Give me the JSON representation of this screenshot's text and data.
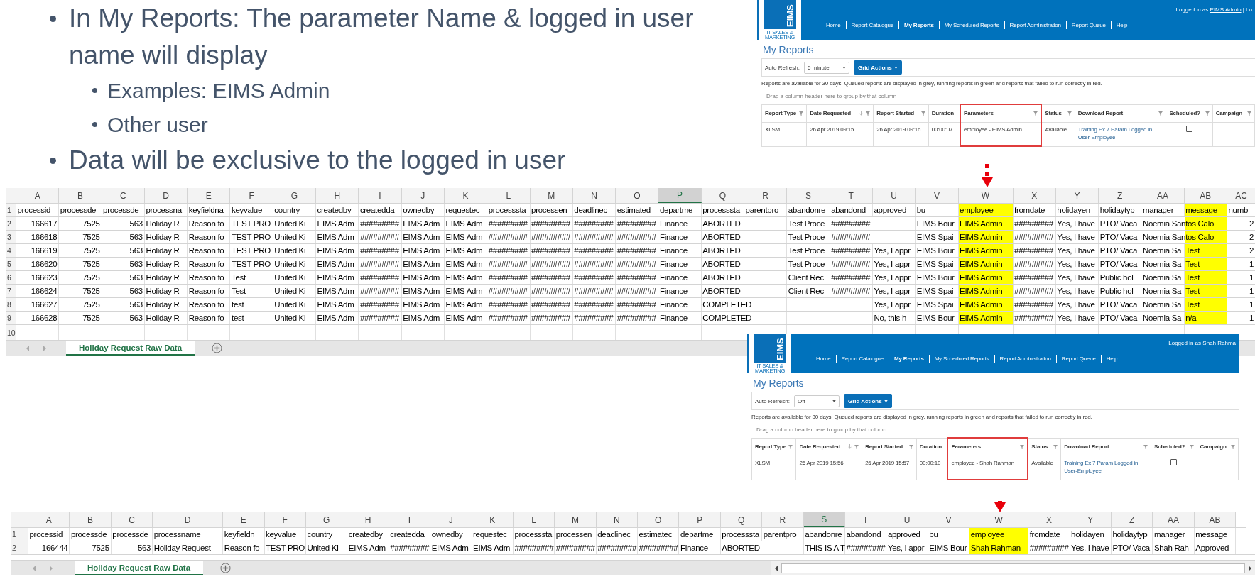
{
  "bullets": [
    {
      "text": "In My Reports: The parameter Name & logged in user name will display",
      "children": [
        {
          "text": "Examples: EIMS Admin"
        },
        {
          "text": "Other user"
        }
      ]
    },
    {
      "text": "Data will be exclusive to the logged in user"
    }
  ],
  "apps": [
    {
      "logo_text": "EIMS",
      "logo_subtitle": "IT SALES & MARKETING",
      "login_label": "Logged in as",
      "user": "EIMS Admin",
      "login_suffix": "| Lo",
      "nav": [
        {
          "label": "Home",
          "selected": false
        },
        {
          "label": "Report Catalogue",
          "selected": false
        },
        {
          "label": "My Reports",
          "selected": true
        },
        {
          "label": "My Scheduled Reports",
          "selected": false
        },
        {
          "label": "Report Administration",
          "selected": false
        },
        {
          "label": "Report Queue",
          "selected": false
        },
        {
          "label": "Help",
          "selected": false
        }
      ],
      "title": "My Reports",
      "auto_refresh_label": "Auto Refresh:",
      "auto_refresh_value": "5 minute",
      "grid_actions": "Grid Actions",
      "info": "Reports are available for 30 days. Queued reports are displayed in grey, running reports in green and reports that failed to run correctly in red.",
      "group_hint": "Drag a column header here to group by that column",
      "columns": [
        {
          "label": "Report Type",
          "sorted": false,
          "filter": true,
          "highlighted": false
        },
        {
          "label": "Date Requested",
          "sorted": true,
          "filter": true,
          "highlighted": false
        },
        {
          "label": "Report Started",
          "sorted": false,
          "filter": true,
          "highlighted": false
        },
        {
          "label": "Duration",
          "sorted": false,
          "filter": false,
          "highlighted": false
        },
        {
          "label": "Parameters",
          "sorted": false,
          "filter": true,
          "highlighted": true
        },
        {
          "label": "Status",
          "sorted": false,
          "filter": true,
          "highlighted": false
        },
        {
          "label": "Download Report",
          "sorted": false,
          "filter": true,
          "highlighted": false
        },
        {
          "label": "Scheduled?",
          "sorted": false,
          "filter": true,
          "highlighted": false
        },
        {
          "label": "Campaign",
          "sorted": false,
          "filter": true,
          "highlighted": false
        }
      ],
      "row": [
        {
          "kind": "text",
          "text": "XLSM"
        },
        {
          "kind": "text",
          "text": "26 Apr 2019 09:15"
        },
        {
          "kind": "text",
          "text": "26 Apr 2019 09:16"
        },
        {
          "kind": "text",
          "text": "00:00:07"
        },
        {
          "kind": "text",
          "text": "employee - EIMS Admin"
        },
        {
          "kind": "text",
          "text": "Available"
        },
        {
          "kind": "link",
          "text": "Training Ex 7 Param Logged in User-Employee"
        },
        {
          "kind": "checkbox",
          "checked": false
        }
      ]
    },
    {
      "logo_text": "EIMS",
      "logo_subtitle": "IT SALES & MARKETING",
      "login_label": "Logged in as",
      "user": "Shah Rahma",
      "nav": [
        {
          "label": "Home",
          "selected": false
        },
        {
          "label": "Report Catalogue",
          "selected": false
        },
        {
          "label": "My Reports",
          "selected": true
        },
        {
          "label": "My Scheduled Reports",
          "selected": false
        },
        {
          "label": "Report Administration",
          "selected": false
        },
        {
          "label": "Report Queue",
          "selected": false
        },
        {
          "label": "Help",
          "selected": false
        }
      ],
      "title": "My Reports",
      "auto_refresh_label": "Auto Refresh:",
      "auto_refresh_value": "Off",
      "grid_actions": "Grid Actions",
      "info": "Reports are available for 30 days. Queued reports are displayed in grey, running reports in green and reports that failed to run correctly in red.",
      "group_hint": "Drag a column header here to group by that column",
      "columns": [
        {
          "label": "Report Type",
          "sorted": false,
          "filter": true,
          "highlighted": false
        },
        {
          "label": "Date Requested",
          "sorted": true,
          "filter": true,
          "highlighted": false
        },
        {
          "label": "Report Started",
          "sorted": false,
          "filter": true,
          "highlighted": false
        },
        {
          "label": "Duration",
          "sorted": false,
          "filter": false,
          "highlighted": false
        },
        {
          "label": "Parameters",
          "sorted": false,
          "filter": true,
          "highlighted": true
        },
        {
          "label": "Status",
          "sorted": false,
          "filter": true,
          "highlighted": false
        },
        {
          "label": "Download Report",
          "sorted": false,
          "filter": true,
          "highlighted": false
        },
        {
          "label": "Scheduled?",
          "sorted": false,
          "filter": true,
          "highlighted": false
        },
        {
          "label": "Campaign",
          "sorted": false,
          "filter": true,
          "highlighted": false
        }
      ],
      "row": [
        {
          "kind": "text",
          "text": "XLSM"
        },
        {
          "kind": "text",
          "text": "26 Apr 2019 15:56"
        },
        {
          "kind": "text",
          "text": "26 Apr 2019 15:57"
        },
        {
          "kind": "text",
          "text": "00:00:10"
        },
        {
          "kind": "text",
          "text": "employee - Shah Rahman"
        },
        {
          "kind": "text",
          "text": "Available"
        },
        {
          "kind": "link",
          "text": "Training Ex 7 Param Logged in User-Employee"
        },
        {
          "kind": "checkbox",
          "checked": false
        }
      ]
    }
  ],
  "sheets": [
    {
      "tab": "Holiday Request Raw Data",
      "columns": [
        {
          "letter": "A",
          "selected": false,
          "highlighted": false
        },
        {
          "letter": "B",
          "selected": false,
          "highlighted": false
        },
        {
          "letter": "C",
          "selected": false,
          "highlighted": false
        },
        {
          "letter": "D",
          "selected": false,
          "highlighted": false
        },
        {
          "letter": "E",
          "selected": false,
          "highlighted": false
        },
        {
          "letter": "F",
          "selected": false,
          "highlighted": false
        },
        {
          "letter": "G",
          "selected": false,
          "highlighted": false
        },
        {
          "letter": "H",
          "selected": false,
          "highlighted": false
        },
        {
          "letter": "I",
          "selected": false,
          "highlighted": false
        },
        {
          "letter": "J",
          "selected": false,
          "highlighted": false
        },
        {
          "letter": "K",
          "selected": false,
          "highlighted": false
        },
        {
          "letter": "L",
          "selected": false,
          "highlighted": false
        },
        {
          "letter": "M",
          "selected": false,
          "highlighted": false
        },
        {
          "letter": "N",
          "selected": false,
          "highlighted": false
        },
        {
          "letter": "O",
          "selected": false,
          "highlighted": false
        },
        {
          "letter": "P",
          "selected": true,
          "highlighted": false
        },
        {
          "letter": "Q",
          "selected": false,
          "highlighted": false
        },
        {
          "letter": "R",
          "selected": false,
          "highlighted": false
        },
        {
          "letter": "S",
          "selected": false,
          "highlighted": false
        },
        {
          "letter": "T",
          "selected": false,
          "highlighted": false
        },
        {
          "letter": "U",
          "selected": false,
          "highlighted": false
        },
        {
          "letter": "V",
          "selected": false,
          "highlighted": false
        },
        {
          "letter": "W",
          "selected": false,
          "highlighted": true
        },
        {
          "letter": "X",
          "selected": false,
          "highlighted": false
        },
        {
          "letter": "Y",
          "selected": false,
          "highlighted": false
        },
        {
          "letter": "Z",
          "selected": false,
          "highlighted": false
        },
        {
          "letter": "AA",
          "selected": false,
          "highlighted": false
        },
        {
          "letter": "AB",
          "selected": false,
          "highlighted": true
        },
        {
          "letter": "AC",
          "selected": false,
          "highlighted": false
        }
      ],
      "rows": [
        {
          "number": "1",
          "cells": [
            "processid",
            "processde",
            "processde",
            "processna",
            "keyfieldna",
            "keyvalue",
            "country",
            "createdby",
            "createdda",
            "ownedby",
            "requestec",
            "processsta",
            "processen",
            "deadlinec",
            "estimated",
            "departme",
            "processsta",
            "parentpro",
            "abandonre",
            "abandond",
            "approved",
            "bu",
            "employee",
            "fromdate",
            "holidayen",
            "holidaytyp",
            "manager",
            "message",
            "numb"
          ]
        },
        {
          "number": "2",
          "cells": [
            "166617",
            "7525",
            "563",
            "Holiday R",
            "Reason fo",
            "TEST PRO",
            "United Ki",
            "EIMS Adm",
            "#########",
            "EIMS Adm",
            "EIMS Adm",
            "#########",
            "#########",
            "#########",
            "#########",
            "Finance",
            "ABORTED",
            "",
            "Test Proce",
            "#########",
            "",
            "EIMS Bour",
            "EIMS Admin",
            "#########",
            "Yes, I have",
            "PTO/ Vaca",
            "Noemia Santos Calo",
            "",
            "2"
          ]
        },
        {
          "number": "3",
          "cells": [
            "166618",
            "7525",
            "563",
            "Holiday R",
            "Reason fo",
            "TEST PRO",
            "United Ki",
            "EIMS Adm",
            "#########",
            "EIMS Adm",
            "EIMS Adm",
            "#########",
            "#########",
            "#########",
            "#########",
            "Finance",
            "ABORTED",
            "",
            "Test Proce",
            "#########",
            "",
            "EIMS Spai",
            "EIMS Admin",
            "#########",
            "Yes, I have",
            "PTO/ Vaca",
            "Noemia Santos Calo",
            "",
            "2"
          ]
        },
        {
          "number": "4",
          "cells": [
            "166619",
            "7525",
            "563",
            "Holiday R",
            "Reason fo",
            "TEST PRO",
            "United Ki",
            "EIMS Adm",
            "#########",
            "EIMS Adm",
            "EIMS Adm",
            "#########",
            "#########",
            "#########",
            "#########",
            "Finance",
            "ABORTED",
            "",
            "Test Proce",
            "#########",
            "Yes, I appr",
            "EIMS Bour",
            "EIMS Admin",
            "#########",
            "Yes, I have",
            "PTO/ Vaca",
            "Noemia Sa",
            "Test",
            "2"
          ]
        },
        {
          "number": "5",
          "cells": [
            "166620",
            "7525",
            "563",
            "Holiday R",
            "Reason fo",
            "TEST PRO",
            "United Ki",
            "EIMS Adm",
            "#########",
            "EIMS Adm",
            "EIMS Adm",
            "#########",
            "#########",
            "#########",
            "#########",
            "Finance",
            "ABORTED",
            "",
            "Test Proce",
            "#########",
            "Yes, I appr",
            "EIMS Spai",
            "EIMS Admin",
            "#########",
            "Yes, I have",
            "PTO/ Vaca",
            "Noemia Sa",
            "Test",
            "1"
          ]
        },
        {
          "number": "6",
          "cells": [
            "166623",
            "7525",
            "563",
            "Holiday R",
            "Reason fo",
            "Test",
            "United Ki",
            "EIMS Adm",
            "#########",
            "EIMS Adm",
            "EIMS Adm",
            "#########",
            "#########",
            "#########",
            "#########",
            "Finance",
            "ABORTED",
            "",
            "Client Rec",
            "#########",
            "Yes, I appr",
            "EIMS Bour",
            "EIMS Admin",
            "#########",
            "Yes, I have",
            "Public hol",
            "Noemia Sa",
            "Test",
            "1"
          ]
        },
        {
          "number": "7",
          "cells": [
            "166624",
            "7525",
            "563",
            "Holiday R",
            "Reason fo",
            "Test",
            "United Ki",
            "EIMS Adm",
            "#########",
            "EIMS Adm",
            "EIMS Adm",
            "#########",
            "#########",
            "#########",
            "#########",
            "Finance",
            "ABORTED",
            "",
            "Client Rec",
            "#########",
            "Yes, I appr",
            "EIMS Spai",
            "EIMS Admin",
            "#########",
            "Yes, I have",
            "Public hol",
            "Noemia Sa",
            "Test",
            "1"
          ]
        },
        {
          "number": "8",
          "cells": [
            "166627",
            "7525",
            "563",
            "Holiday R",
            "Reason fo",
            "test",
            "United Ki",
            "EIMS Adm",
            "#########",
            "EIMS Adm",
            "EIMS Adm",
            "#########",
            "#########",
            "#########",
            "#########",
            "Finance",
            "COMPLETED",
            "",
            "",
            "",
            "Yes, I appr",
            "EIMS Spai",
            "EIMS Admin",
            "#########",
            "Yes, I have",
            "PTO/ Vaca",
            "Noemia Sa",
            "Test",
            "1"
          ]
        },
        {
          "number": "9",
          "cells": [
            "166628",
            "7525",
            "563",
            "Holiday R",
            "Reason fo",
            "test",
            "United Ki",
            "EIMS Adm",
            "#########",
            "EIMS Adm",
            "EIMS Adm",
            "#########",
            "#########",
            "#########",
            "#########",
            "Finance",
            "COMPLETED",
            "",
            "",
            "",
            "No, this h",
            "EIMS Bour",
            "EIMS Admin",
            "#########",
            "Yes, I have",
            "PTO/ Vaca",
            "Noemia Sa",
            "n/a",
            "1"
          ]
        },
        {
          "number": "10",
          "cells": []
        }
      ]
    },
    {
      "tab": "Holiday Request Raw Data",
      "columns": [
        {
          "letter": "A",
          "selected": false,
          "highlighted": false
        },
        {
          "letter": "B",
          "selected": false,
          "highlighted": false
        },
        {
          "letter": "C",
          "selected": false,
          "highlighted": false
        },
        {
          "letter": "D",
          "selected": false,
          "highlighted": false
        },
        {
          "letter": "E",
          "selected": false,
          "highlighted": false
        },
        {
          "letter": "F",
          "selected": false,
          "highlighted": false
        },
        {
          "letter": "G",
          "selected": false,
          "highlighted": false
        },
        {
          "letter": "H",
          "selected": false,
          "highlighted": false
        },
        {
          "letter": "I",
          "selected": false,
          "highlighted": false
        },
        {
          "letter": "J",
          "selected": false,
          "highlighted": false
        },
        {
          "letter": "K",
          "selected": false,
          "highlighted": false
        },
        {
          "letter": "L",
          "selected": false,
          "highlighted": false
        },
        {
          "letter": "M",
          "selected": false,
          "highlighted": false
        },
        {
          "letter": "N",
          "selected": false,
          "highlighted": false
        },
        {
          "letter": "O",
          "selected": false,
          "highlighted": false
        },
        {
          "letter": "P",
          "selected": false,
          "highlighted": false
        },
        {
          "letter": "Q",
          "selected": false,
          "highlighted": false
        },
        {
          "letter": "R",
          "selected": false,
          "highlighted": false
        },
        {
          "letter": "S",
          "selected": true,
          "highlighted": false
        },
        {
          "letter": "T",
          "selected": false,
          "highlighted": false
        },
        {
          "letter": "U",
          "selected": false,
          "highlighted": false
        },
        {
          "letter": "V",
          "selected": false,
          "highlighted": false
        },
        {
          "letter": "W",
          "selected": false,
          "highlighted": true
        },
        {
          "letter": "X",
          "selected": false,
          "highlighted": false
        },
        {
          "letter": "Y",
          "selected": false,
          "highlighted": false
        },
        {
          "letter": "Z",
          "selected": false,
          "highlighted": false
        },
        {
          "letter": "AA",
          "selected": false,
          "highlighted": false
        },
        {
          "letter": "AB",
          "selected": false,
          "highlighted": false
        }
      ],
      "rows": [
        {
          "number": "1",
          "cells": [
            "processid",
            "processde",
            "processde",
            "processname",
            "keyfieldn",
            "keyvalue",
            "country",
            "createdby",
            "createdda",
            "ownedby",
            "requestec",
            "processsta",
            "processen",
            "deadlinec",
            "estimatec",
            "departme",
            "processsta",
            "parentpro",
            "abandonre",
            "abandond",
            "approved",
            "bu",
            "employee",
            "fromdate",
            "holidayen",
            "holidaytyp",
            "manager",
            "message"
          ]
        },
        {
          "number": "2",
          "cells": [
            "166444",
            "7525",
            "563",
            "Holiday Request",
            "Reason fo",
            "TEST PRO",
            "United Ki",
            "EIMS Adm",
            "#########",
            "EIMS Adm",
            "EIMS Adm",
            "#########",
            "#########",
            "#########",
            "#########",
            "Finance",
            "ABORTED",
            "",
            "THIS IS A T",
            "#########",
            "Yes, I appr",
            "EIMS Bour",
            "Shah Rahman",
            "#########",
            "Yes, I have",
            "PTO/ Vaca",
            "Shah Rah",
            "Approved"
          ]
        }
      ]
    }
  ]
}
